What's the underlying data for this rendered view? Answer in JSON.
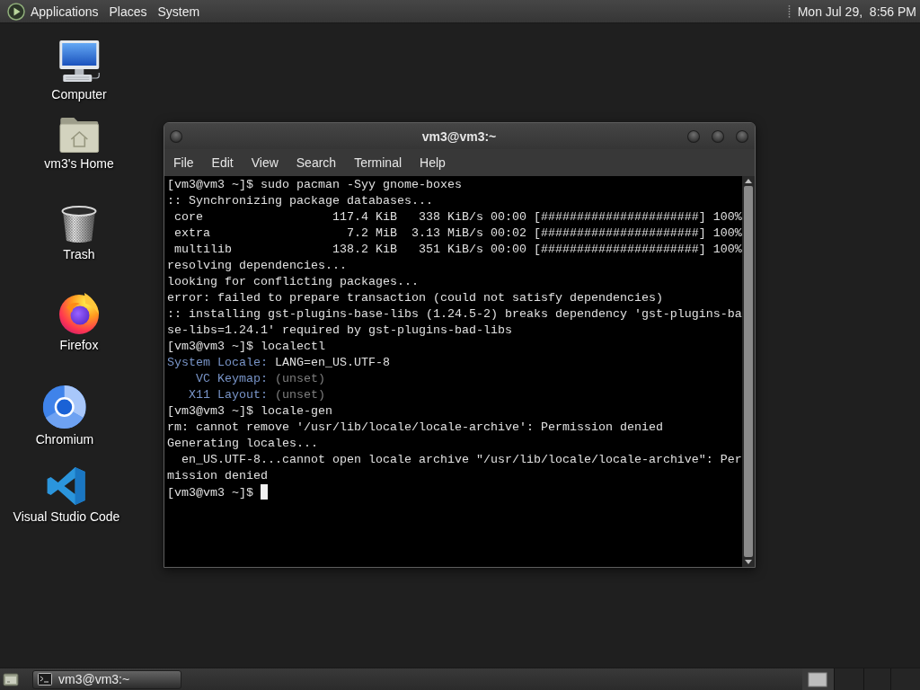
{
  "top_panel": {
    "menus": [
      "Applications",
      "Places",
      "System"
    ],
    "clock": "Mon Jul 29,  8:56 PM"
  },
  "desktop_icons": [
    {
      "label": "Computer",
      "kind": "computer"
    },
    {
      "label": "vm3's Home",
      "kind": "home"
    },
    {
      "label": "Trash",
      "kind": "trash"
    },
    {
      "label": "Firefox",
      "kind": "firefox"
    },
    {
      "label": "Chromium",
      "kind": "chromium"
    },
    {
      "label": "Visual Studio Code",
      "kind": "vscode"
    }
  ],
  "terminal": {
    "title": "vm3@vm3:~",
    "menus": [
      "File",
      "Edit",
      "View",
      "Search",
      "Terminal",
      "Help"
    ],
    "lines": [
      {
        "kind": "text",
        "text": "[vm3@vm3 ~]$ sudo pacman -Syy gnome-boxes"
      },
      {
        "kind": "text",
        "text": ":: Synchronizing package databases..."
      },
      {
        "kind": "text",
        "text": " core                  117.4 KiB   338 KiB/s 00:00 [######################] 100%"
      },
      {
        "kind": "text",
        "text": " extra                   7.2 MiB  3.13 MiB/s 00:02 [######################] 100%"
      },
      {
        "kind": "text",
        "text": " multilib              138.2 KiB   351 KiB/s 00:00 [######################] 100%"
      },
      {
        "kind": "text",
        "text": "resolving dependencies..."
      },
      {
        "kind": "text",
        "text": "looking for conflicting packages..."
      },
      {
        "kind": "text",
        "text": "error: failed to prepare transaction (could not satisfy dependencies)"
      },
      {
        "kind": "text",
        "text": ":: installing gst-plugins-base-libs (1.24.5-2) breaks dependency 'gst-plugins-ba"
      },
      {
        "kind": "text",
        "text": "se-libs=1.24.1' required by gst-plugins-bad-libs"
      },
      {
        "kind": "text",
        "text": "[vm3@vm3 ~]$ localectl"
      },
      {
        "kind": "field",
        "label": "System Locale:",
        "value": "LANG=en_US.UTF-8",
        "unset": false
      },
      {
        "kind": "field",
        "label": "VC Keymap:",
        "value": "(unset)",
        "unset": true
      },
      {
        "kind": "field",
        "label": "X11 Layout:",
        "value": "(unset)",
        "unset": true
      },
      {
        "kind": "text",
        "text": "[vm3@vm3 ~]$ locale-gen"
      },
      {
        "kind": "text",
        "text": "rm: cannot remove '/usr/lib/locale/locale-archive': Permission denied"
      },
      {
        "kind": "text",
        "text": "Generating locales..."
      },
      {
        "kind": "text",
        "text": "  en_US.UTF-8...cannot open locale archive \"/usr/lib/locale/locale-archive\": Per"
      },
      {
        "kind": "text",
        "text": "mission denied"
      },
      {
        "kind": "prompt",
        "text": "[vm3@vm3 ~]$",
        "cursor": true
      }
    ]
  },
  "taskbar": {
    "tasks": [
      {
        "label": "vm3@vm3:~",
        "selected": true
      }
    ]
  }
}
